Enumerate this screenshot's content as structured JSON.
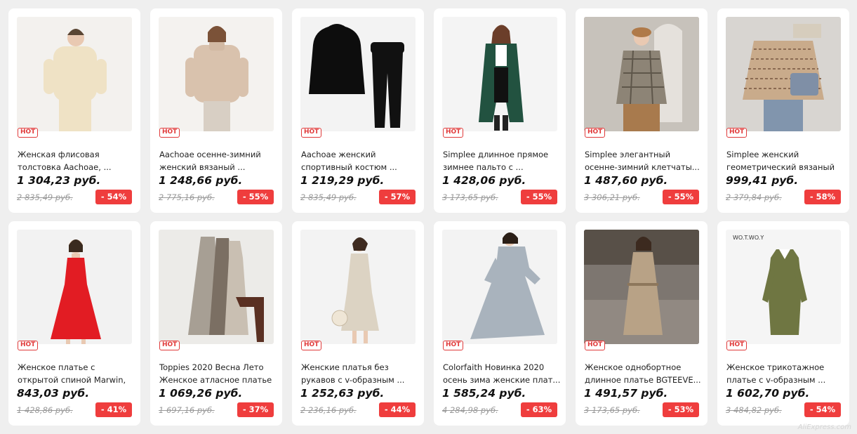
{
  "hot_label": "HOT",
  "watermark": "AliExpress.com",
  "products": [
    {
      "title": "Женская флисовая толстовка Aachoae, ...",
      "price": "1 304,23 руб.",
      "old_price": "2 835,49 руб.",
      "discount": "- 54%",
      "image": "cream-hoodie-set"
    },
    {
      "title": "Aachoae осенне-зимний женский вязаный ...",
      "price": "1 248,66 руб.",
      "old_price": "2 775,16 руб.",
      "discount": "- 55%",
      "image": "beige-turtleneck-sweater"
    },
    {
      "title": "Aachoae женский спортивный костюм ...",
      "price": "1 219,29 руб.",
      "old_price": "2 835,49 руб.",
      "discount": "- 57%",
      "image": "black-hoodie-tracksuit"
    },
    {
      "title": "Simplee длинное прямое зимнее пальто с ...",
      "price": "1 428,06 руб.",
      "old_price": "3 173,65 руб.",
      "discount": "- 55%",
      "image": "green-long-coat"
    },
    {
      "title": "Simplee элегантный осенне-зимний клетчаты...",
      "price": "1 487,60 руб.",
      "old_price": "3 306,21 руб.",
      "discount": "- 55%",
      "image": "plaid-blazer"
    },
    {
      "title": "Simplee женский геометрический вязаный ...",
      "price": "999,41 руб.",
      "old_price": "2 379,84 руб.",
      "discount": "- 58%",
      "image": "houndstooth-sweater"
    },
    {
      "title": "Женское платье с открытой спиной Marwin, ...",
      "price": "843,03 руб.",
      "old_price": "1 428,86 руб.",
      "discount": "- 41%",
      "image": "red-slip-dress"
    },
    {
      "title": "Toppies 2020 Весна Лето Женское атласное платье ...",
      "price": "1 069,26 руб.",
      "old_price": "1 697,16 руб.",
      "discount": "- 37%",
      "image": "satin-slip-dresses"
    },
    {
      "title": "Женские платья без рукавов с v-образным ...",
      "price": "1 252,63 руб.",
      "old_price": "2 236,16 руб.",
      "discount": "- 44%",
      "image": "ivory-satin-dress"
    },
    {
      "title": "Colorfaith Новинка 2020 осень зима женские плат...",
      "price": "1 585,24 руб.",
      "old_price": "4 284,98 руб.",
      "discount": "- 63%",
      "image": "grey-knit-dress"
    },
    {
      "title": "Женское однобортное длинное платье BGTEEVE...",
      "price": "1 491,57 руб.",
      "old_price": "3 173,65 руб.",
      "discount": "- 53%",
      "image": "beige-shirt-dress"
    },
    {
      "title": "Женское трикотажное платье с v-образным ...",
      "price": "1 602,70 руб.",
      "old_price": "3 484,82 руб.",
      "discount": "- 54%",
      "image": "olive-knit-dress",
      "brand_text": "WO.T.WO.Y"
    }
  ]
}
